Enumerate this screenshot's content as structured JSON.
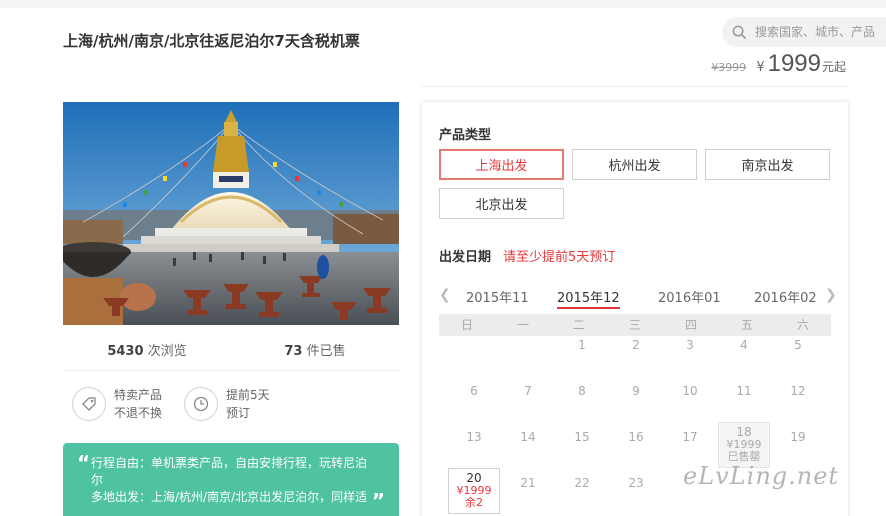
{
  "product": {
    "title": "上海/杭州/南京/北京往返尼泊尔7天含税机票"
  },
  "search": {
    "placeholder": "搜索国家、城市、产品"
  },
  "price": {
    "old": "¥3999",
    "symbol": "¥",
    "current": "1999",
    "unit": "元起"
  },
  "stats": {
    "views_count": "5430",
    "views_label": "次浏览",
    "sold_count": "73",
    "sold_label": "件已售"
  },
  "features": [
    {
      "line1": "特卖产品",
      "line2": "不退不换",
      "icon": "tag-icon"
    },
    {
      "line1": "提前5天",
      "line2": "预订",
      "icon": "clock-icon"
    }
  ],
  "notice": {
    "quote_open": "“",
    "quote_close": "”",
    "line1": "行程自由：单机票类产品，自由安排行程，玩转尼泊尔",
    "line2": "多地出发：上海/杭州/南京/北京出发尼泊尔，同样适"
  },
  "booking": {
    "type_label": "产品类型",
    "types": [
      "上海出发",
      "杭州出发",
      "南京出发",
      "北京出发"
    ],
    "selected_type": "上海出发",
    "date_label": "出发日期",
    "date_note": "请至少提前5天预订",
    "months": [
      "2015年11",
      "2015年12",
      "2016年01",
      "2016年02"
    ],
    "selected_month": "2015年12",
    "weekdays": [
      "日",
      "一",
      "二",
      "三",
      "四",
      "五",
      "六"
    ],
    "days": {
      "d1": "1",
      "d2": "2",
      "d3": "3",
      "d4": "4",
      "d5": "5",
      "d6": "6",
      "d7": "7",
      "d8": "8",
      "d9": "9",
      "d10": "10",
      "d11": "11",
      "d12": "12",
      "d13": "13",
      "d14": "14",
      "d15": "15",
      "d16": "16",
      "d17": "17",
      "d18": "18",
      "d19": "19",
      "d20": "20",
      "d21": "21",
      "d22": "22",
      "d23": "23"
    },
    "day18_price": "¥1999",
    "day18_status": "已售罄",
    "day20_price": "¥1999",
    "day20_stock": "余2"
  },
  "colors": {
    "accent": "#e4393c",
    "notice_bg": "#4fc3a1"
  }
}
